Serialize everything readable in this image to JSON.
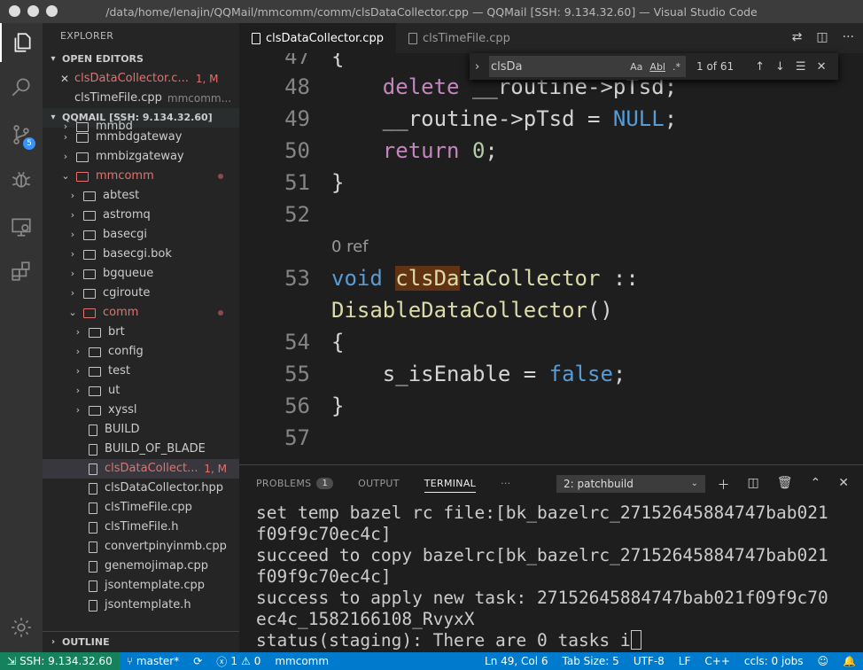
{
  "window": {
    "title": "/data/home/lenajin/QQMail/mmcomm/comm/clsDataCollector.cpp — QQMail [SSH: 9.134.32.60] — Visual Studio Code"
  },
  "activity": {
    "scm_badge": "5"
  },
  "sidebar": {
    "title": "EXPLORER",
    "open_editors_label": "OPEN EDITORS",
    "open_editors": [
      {
        "name": "clsDataCollector.c...",
        "badge": "1, M",
        "path": ""
      },
      {
        "name": "clsTimeFile.cpp",
        "badge": "",
        "path": "mmcomm..."
      }
    ],
    "workspace_label": "QQMAIL [SSH: 9.134.32.60]",
    "tree": [
      {
        "name": "mmbd"
      },
      {
        "name": "mmbdgateway"
      },
      {
        "name": "mmbizgateway"
      },
      {
        "name": "mmcomm"
      },
      {
        "name": "abtest"
      },
      {
        "name": "astromq"
      },
      {
        "name": "basecgi"
      },
      {
        "name": "basecgi.bok"
      },
      {
        "name": "bgqueue"
      },
      {
        "name": "cgiroute"
      },
      {
        "name": "comm"
      },
      {
        "name": "brt"
      },
      {
        "name": "config"
      },
      {
        "name": "test"
      },
      {
        "name": "ut"
      },
      {
        "name": "xyssl"
      },
      {
        "name": "BUILD"
      },
      {
        "name": "BUILD_OF_BLADE"
      },
      {
        "name": "clsDataCollect...",
        "badge": "1, M"
      },
      {
        "name": "clsDataCollector.hpp"
      },
      {
        "name": "clsTimeFile.cpp"
      },
      {
        "name": "clsTimeFile.h"
      },
      {
        "name": "convertpinyinmb.cpp"
      },
      {
        "name": "genemojimap.cpp"
      },
      {
        "name": "jsontemplate.cpp"
      },
      {
        "name": "jsontemplate.h"
      }
    ],
    "outline_label": "OUTLINE"
  },
  "tabs": [
    {
      "label": "clsDataCollector.cpp"
    },
    {
      "label": "clsTimeFile.cpp"
    }
  ],
  "find": {
    "query": "clsDa",
    "count": "1 of 61",
    "opt_case": "Aa",
    "opt_word": "Abl",
    "opt_regex": ".*"
  },
  "editor": {
    "line_numbers": [
      "47",
      "48",
      "49",
      "50",
      "51",
      "52",
      "53",
      "54",
      "55",
      "56",
      "57"
    ],
    "codelens": "0 ref",
    "tokens": {
      "l47": "{",
      "l48_kw": "delete",
      "l48_rest": "__routine->pTsd;",
      "l49_a": "__routine->pTsd = ",
      "l49_null": "NULL",
      "l49_end": ";",
      "l50_kw": "return",
      "l50_num": "0",
      "l50_end": ";",
      "l51": "}",
      "l53_void": "void",
      "l53_hl": "clsDa",
      "l53_cls": "taCollector",
      "l53_sep": " ::",
      "l53_fn": "DisableDataCollector",
      "l53_paren": "()",
      "l54": "{",
      "l55_var": "s_isEnable = ",
      "l55_false": "false",
      "l55_end": ";",
      "l56": "}"
    }
  },
  "panel": {
    "tabs": [
      {
        "label": "PROBLEMS",
        "badge": "1"
      },
      {
        "label": "OUTPUT"
      },
      {
        "label": "TERMINAL"
      },
      {
        "label": "···"
      }
    ],
    "terminal_select": "2: patchbuild",
    "lines": [
      "set temp bazel rc file:[bk_bazelrc_27152645884747bab021",
      "f09f9c70ec4c]",
      "succeed to copy bazelrc[bk_bazelrc_27152645884747bab021",
      "f09f9c70ec4c]",
      "success to apply new task: 27152645884747bab021f09f9c70",
      "ec4c_1582166108_RvyxX",
      "status(staging): There are 0 tasks i"
    ]
  },
  "status": {
    "remote": "SSH: 9.134.32.60",
    "branch": "master*",
    "errors": "1",
    "warnings": "0",
    "project": "mmcomm",
    "position": "Ln 49, Col 6",
    "tabsize": "Tab Size: 5",
    "encoding": "UTF-8",
    "eol": "LF",
    "language": "C++",
    "ccls": "ccls: 0 jobs"
  }
}
